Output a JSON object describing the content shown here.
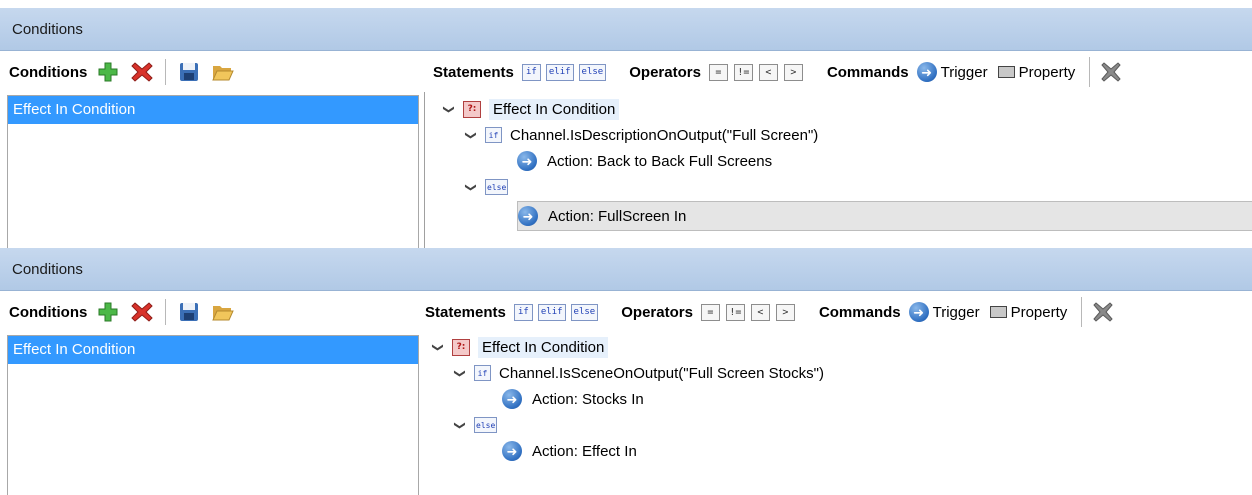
{
  "colors": {
    "header": "#b9cfea",
    "selected": "#3399ff"
  },
  "panels": [
    {
      "header": "Conditions",
      "toolbar": {
        "title": "Conditions",
        "add_icon": "green-plus-icon",
        "delete_icon": "red-x-icon",
        "save_icon": "floppy-disk-icon",
        "open_icon": "folder-open-icon"
      },
      "list": {
        "items": [
          "Effect In Condition"
        ]
      },
      "right_toolbar": {
        "statements_label": "Statements",
        "statements": [
          "if",
          "elif",
          "else"
        ],
        "operators_label": "Operators",
        "operators": [
          "=",
          "!=",
          "<",
          ">"
        ],
        "commands_label": "Commands",
        "trigger_label": "Trigger",
        "property_label": "Property"
      },
      "tree": {
        "root": "Effect In Condition",
        "root_icon": "?:",
        "if_icon": "if",
        "if_condition": "Channel.IsDescriptionOnOutput(\"Full Screen\")",
        "if_action": "Action: Back to Back Full Screens",
        "else_icon": "else",
        "else_action": "Action: FullScreen In"
      }
    },
    {
      "header": "Conditions",
      "toolbar": {
        "title": "Conditions",
        "add_icon": "green-plus-icon",
        "delete_icon": "red-x-icon",
        "save_icon": "floppy-disk-icon",
        "open_icon": "folder-open-icon"
      },
      "list": {
        "items": [
          "Effect In Condition"
        ]
      },
      "right_toolbar": {
        "statements_label": "Statements",
        "statements": [
          "if",
          "elif",
          "else"
        ],
        "operators_label": "Operators",
        "operators": [
          "=",
          "!=",
          "<",
          ">"
        ],
        "commands_label": "Commands",
        "trigger_label": "Trigger",
        "property_label": "Property"
      },
      "tree": {
        "root": "Effect In Condition",
        "root_icon": "?:",
        "if_icon": "if",
        "if_condition": "Channel.IsSceneOnOutput(\"Full Screen Stocks\")",
        "if_action": "Action: Stocks In",
        "else_icon": "else",
        "else_action": "Action: Effect In"
      }
    }
  ]
}
